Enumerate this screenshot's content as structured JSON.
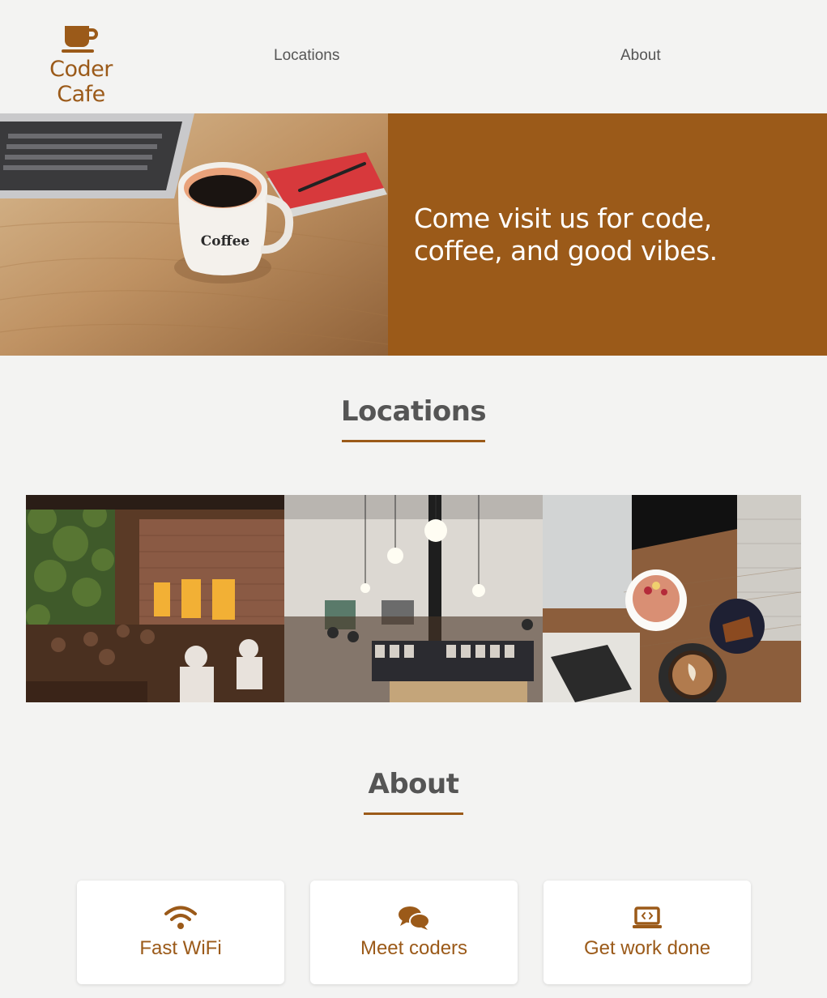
{
  "brand": {
    "name": "Coder Cafe",
    "logo_icon": "coffee-cup-icon",
    "accent_color": "#9b5a19",
    "background_color": "#f3f3f2"
  },
  "nav": {
    "items": [
      {
        "label": "Locations"
      },
      {
        "label": "About"
      }
    ]
  },
  "hero": {
    "image_mug_text": "Coffee",
    "tagline": "Come visit us for code, coffee, and good vibes."
  },
  "locations": {
    "title": "Locations",
    "photos": [
      {
        "icon": "cafe-interior-photo"
      },
      {
        "icon": "coffee-bar-photo"
      },
      {
        "icon": "latte-table-photo"
      }
    ]
  },
  "about": {
    "title": "About",
    "features": [
      {
        "label": "Fast WiFi",
        "icon": "wifi-icon"
      },
      {
        "label": "Meet coders",
        "icon": "chat-bubbles-icon"
      },
      {
        "label": "Get work done",
        "icon": "laptop-code-icon"
      }
    ]
  }
}
